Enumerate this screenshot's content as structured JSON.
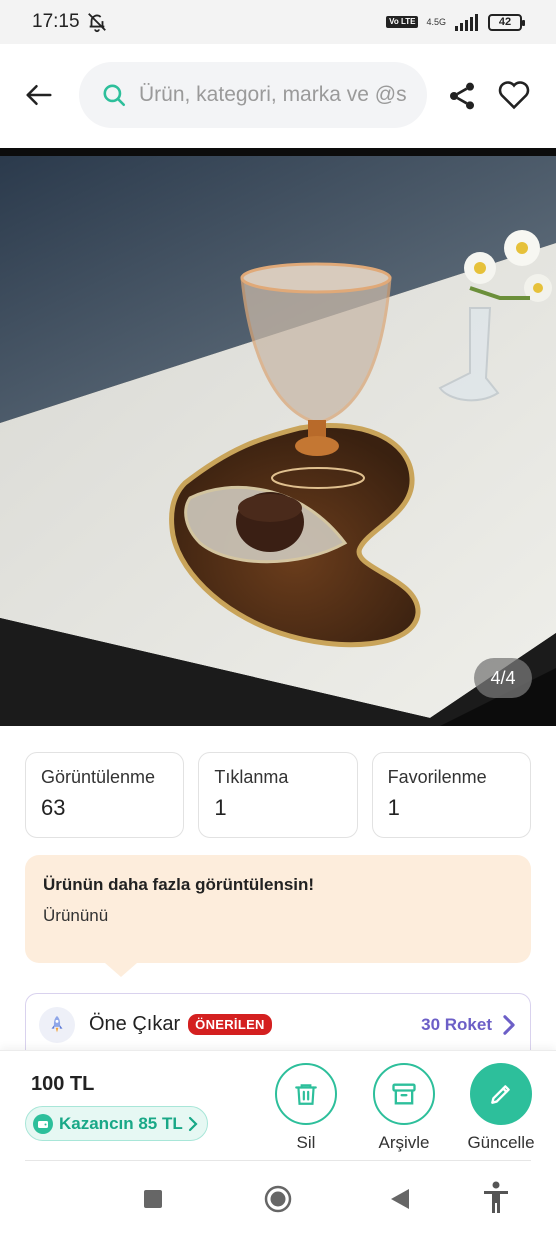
{
  "status_bar": {
    "time": "17:15",
    "network": "4.5G",
    "volte": "Vo LTE",
    "battery": "42"
  },
  "header": {
    "search_placeholder": "Ürün, kategori, marka ve @s"
  },
  "gallery": {
    "indicator": "4/4"
  },
  "stats": [
    {
      "label": "Görüntülenme",
      "value": "63"
    },
    {
      "label": "Tıklanma",
      "value": "1"
    },
    {
      "label": "Favorilenme",
      "value": "1"
    }
  ],
  "promo": {
    "title": "Ürünün daha fazla görüntülensin!",
    "subtitle": "Ürününü"
  },
  "boost": {
    "label": "Öne Çıkar",
    "badge": "ÖNERİLEN",
    "price": "30 Roket"
  },
  "bottom": {
    "price": "100 TL",
    "earn": "Kazancın 85 TL",
    "actions": {
      "delete": "Sil",
      "archive": "Arşivle",
      "update": "Güncelle"
    }
  },
  "colors": {
    "accent": "#2dbf9b",
    "badge": "#d42020",
    "promo_bg": "#fdeddc",
    "boost_price": "#6c5fc7"
  },
  "icons": [
    "back-arrow-icon",
    "search-icon",
    "share-icon",
    "heart-icon",
    "rocket-icon",
    "chevron-right-icon",
    "trash-icon",
    "archive-icon",
    "pencil-icon",
    "wallet-icon",
    "square-icon",
    "circle-home-icon",
    "triangle-back-icon",
    "accessibility-icon",
    "bell-off-icon"
  ]
}
